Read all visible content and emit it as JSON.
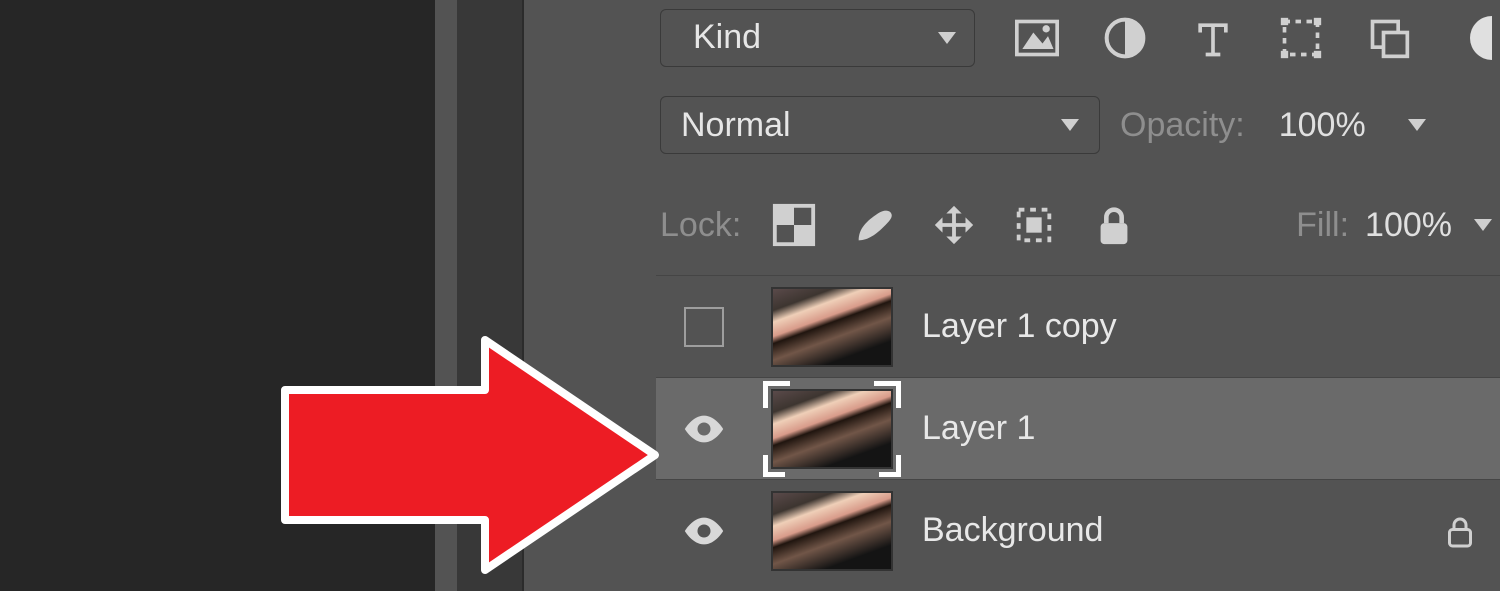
{
  "filter": {
    "label": "Kind",
    "types": [
      "image",
      "adjustment",
      "type",
      "shape",
      "smart-object"
    ]
  },
  "blend": {
    "mode": "Normal",
    "opacity_label": "Opacity:",
    "opacity_value": "100%"
  },
  "lock": {
    "label": "Lock:",
    "fill_label": "Fill:",
    "fill_value": "100%"
  },
  "layers": [
    {
      "name": "Layer 1 copy",
      "visible": false,
      "selected": false,
      "locked": false
    },
    {
      "name": "Layer 1",
      "visible": true,
      "selected": true,
      "locked": false
    },
    {
      "name": "Background",
      "visible": true,
      "selected": false,
      "locked": true
    }
  ]
}
